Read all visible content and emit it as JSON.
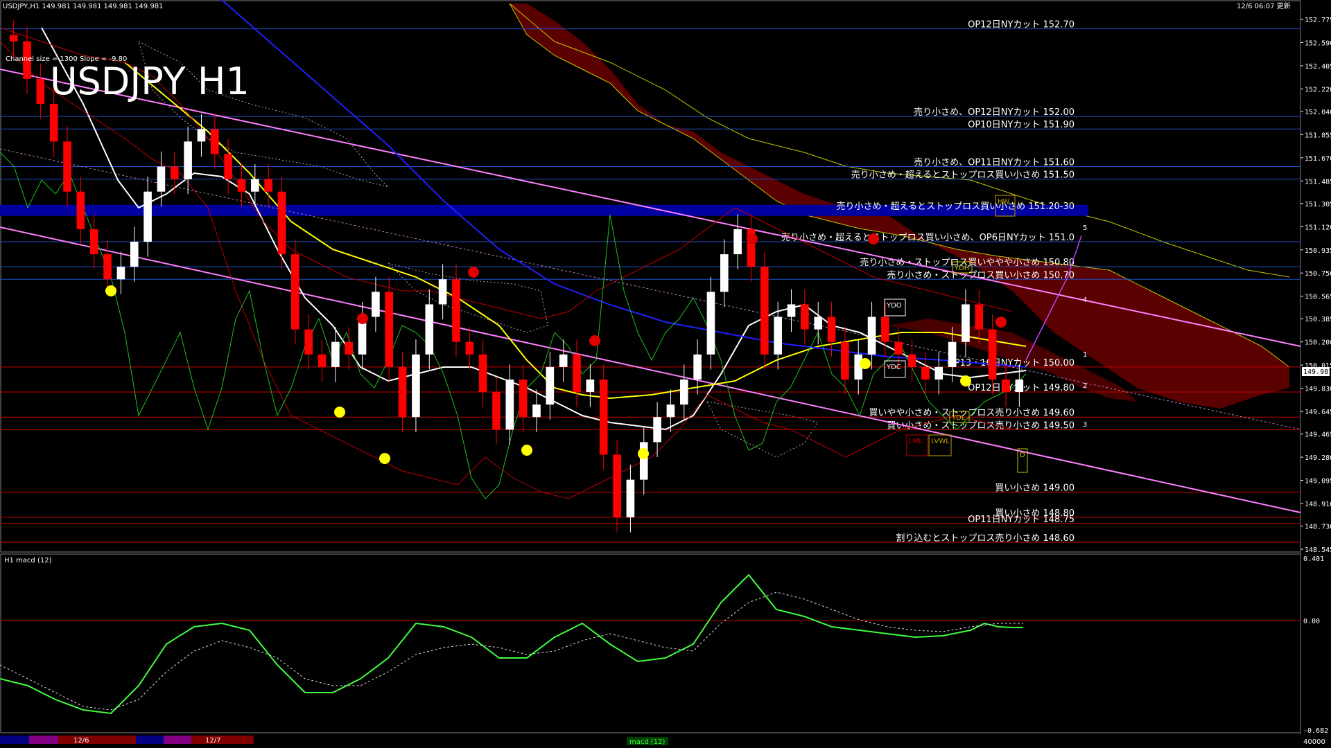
{
  "window": {
    "symbol_info": "USDJPY,H1  149.981 149.981 149.981 149.981",
    "channel_info": "Channel size = 1300  Slope = -9.80",
    "server_time": "12/6 06:07 更新",
    "big_title": "USDJPY H1",
    "indicator_label": "H1 macd (12)",
    "price_tag": "149.981",
    "macd_tab": "macd (12)"
  },
  "colors": {
    "background": "#000000",
    "bull_candle": "#ffffff",
    "bear_candle": "#ff0000",
    "ichimoku_cloud": "#b00000",
    "level_line_blue": "#1e50c8",
    "level_line_red": "#c80000",
    "ma_yellow": "#ffff00",
    "ma_blue": "#2020ff",
    "channel_pink": "#ff80ff",
    "macd_green": "#40ff40",
    "macd_pink": "#ff80c0"
  },
  "price_axis": {
    "ticks": [
      "152.775",
      "152.590",
      "152.405",
      "152.220",
      "152.040",
      "151.855",
      "151.670",
      "151.485",
      "151.305",
      "151.120",
      "150.935",
      "150.750",
      "150.565",
      "150.385",
      "150.200",
      "150.015",
      "149.830",
      "149.645",
      "149.465",
      "149.280",
      "149.095",
      "148.910",
      "148.730",
      "148.545"
    ],
    "min": 148.545,
    "max": 152.775
  },
  "macd_axis": {
    "ticks": [
      "0.401",
      "0.00",
      "-0.682"
    ],
    "bottom_value": "40000"
  },
  "levels": [
    {
      "price": 152.7,
      "text": "OP12日NYカット 152.70",
      "color": "blue"
    },
    {
      "price": 152.0,
      "text": "売り小さめ、OP12日NYカット 152.00",
      "color": "blue"
    },
    {
      "price": 151.9,
      "text": "OP10日NYカット 151.90",
      "color": "blue"
    },
    {
      "price": 151.6,
      "text": "売り小さめ、OP11日NYカット 151.60",
      "color": "blue"
    },
    {
      "price": 151.5,
      "text": "売り小さめ・超えるとストップロス買い小さめ 151.50",
      "color": "blue"
    },
    {
      "price": 151.25,
      "text": "売り小さめ・超えるとストップロス買い小さめ 151.20-30",
      "color": "band"
    },
    {
      "price": 151.0,
      "text": "売り小さめ・超えるとストップロス買い小さめ、OP6日NYカット 151.0",
      "color": "blue"
    },
    {
      "price": 150.8,
      "text": "売り小さめ・ストップロス買いややや小さめ 150.80",
      "color": "blue"
    },
    {
      "price": 150.7,
      "text": "売り小さめ・ストップロス買い小さめ 150.70",
      "color": "blue"
    },
    {
      "price": 150.0,
      "text": "OP13・16日NYカット 150.00",
      "color": "red"
    },
    {
      "price": 149.8,
      "text": "OP12日NYカット 149.80",
      "color": "red"
    },
    {
      "price": 149.6,
      "text": "買いやや小さめ・ストップロス売り小さめ 149.60",
      "color": "red"
    },
    {
      "price": 149.5,
      "text": "買い小さめ・ストップロス売り小さめ 149.50",
      "color": "red"
    },
    {
      "price": 149.0,
      "text": "買い小さめ 149.00",
      "color": "red"
    },
    {
      "price": 148.8,
      "text": "買い小さめ 148.80",
      "color": "red"
    },
    {
      "price": 148.75,
      "text": "OP11日NYカット 148.75",
      "color": "red"
    },
    {
      "price": 148.6,
      "text": "割り込むとストップロス売り小さめ 148.60",
      "color": "red"
    }
  ],
  "boxes": [
    {
      "label": "YDO"
    },
    {
      "label": "YDC"
    },
    {
      "label": "YDL"
    },
    {
      "label": "LML"
    },
    {
      "label": "LVWL"
    },
    {
      "label": "YDH"
    },
    {
      "label": "HW"
    },
    {
      "label": "D"
    }
  ],
  "channel_numbers": [
    "5",
    "4",
    "1",
    "2",
    "3"
  ],
  "date_labels": [
    "12/6",
    "12/7"
  ],
  "chart_data": {
    "type": "candlestick",
    "title": "USDJPY H1",
    "close": [
      152.6,
      152.3,
      152.1,
      151.8,
      151.4,
      151.1,
      150.9,
      150.7,
      150.8,
      151.0,
      151.4,
      151.6,
      151.5,
      151.8,
      151.9,
      151.7,
      151.5,
      151.4,
      151.5,
      151.4,
      150.9,
      150.3,
      150.1,
      150.0,
      150.2,
      150.1,
      150.4,
      150.6,
      150.0,
      149.6,
      150.1,
      150.5,
      150.7,
      150.2,
      150.1,
      149.8,
      149.5,
      149.9,
      149.6,
      149.7,
      150.0,
      150.1,
      149.8,
      149.9,
      149.3,
      148.8,
      149.1,
      149.4,
      149.6,
      149.7,
      149.9,
      150.1,
      150.6,
      150.9,
      151.1,
      150.8,
      150.1,
      150.4,
      150.5,
      150.3,
      150.4,
      150.2,
      149.9,
      150.1,
      150.4,
      150.2,
      150.1,
      150.0,
      149.9,
      150.0,
      150.2,
      150.5,
      150.3,
      149.9,
      149.8,
      149.9
    ],
    "ylim": [
      148.545,
      152.775
    ]
  }
}
